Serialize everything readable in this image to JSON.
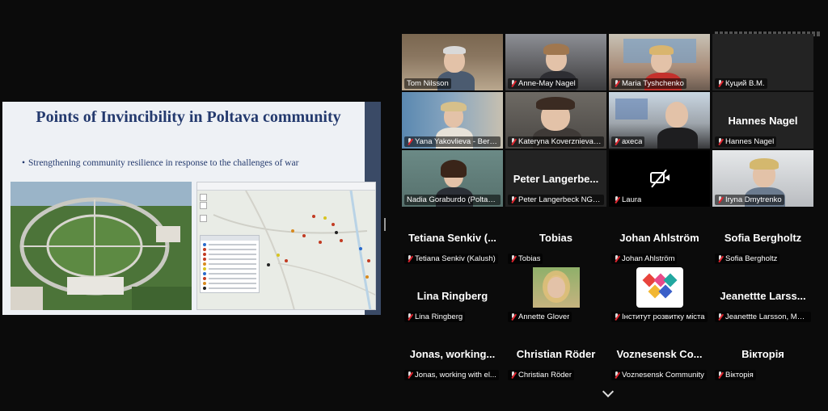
{
  "slide": {
    "title": "Points of Invincibility in Poltava community",
    "bullet": "Strengthening community resilience in response to the challenges of war",
    "bullet_marker": "•"
  },
  "participants": [
    {
      "display_name": "Tom Nilsson",
      "muted": false,
      "video": true
    },
    {
      "display_name": "Anne-May Nagel",
      "muted": true,
      "video": true
    },
    {
      "display_name": "Maria Tyshchenko",
      "muted": true,
      "video": true
    },
    {
      "display_name": "Куций В.М.",
      "muted": true,
      "video": false
    },
    {
      "display_name": "Yana Yakovlieva - Bery...",
      "muted": true,
      "video": true
    },
    {
      "display_name": "Kateryna Koverznieva ...",
      "muted": true,
      "video": true
    },
    {
      "display_name": "axeca",
      "muted": true,
      "video": true
    },
    {
      "display_name": "Hannes Nagel",
      "big_name": "Hannes Nagel",
      "muted": true,
      "video": false
    },
    {
      "display_name": "Nadia Goraburdo (Poltava)",
      "muted": false,
      "video": true,
      "active_speaker": true
    },
    {
      "display_name": "Peter Langerbeck NGO...",
      "big_name": "Peter Langerbe...",
      "muted": true,
      "video": false
    },
    {
      "display_name": "Laura",
      "muted": true,
      "video": false,
      "camera_off": true
    },
    {
      "display_name": "Iryna Dmytrenko",
      "muted": true,
      "video": true
    },
    {
      "display_name": "Tetiana Senkiv (Kalush)",
      "big_name": "Tetiana Senkiv (...",
      "muted": true,
      "video": false
    },
    {
      "display_name": "Tobias",
      "big_name": "Tobias",
      "muted": true,
      "video": false
    },
    {
      "display_name": "Johan Ahlström",
      "big_name": "Johan Ahlström",
      "muted": true,
      "video": false
    },
    {
      "display_name": "Sofia Bergholtz",
      "big_name": "Sofia Bergholtz",
      "muted": true,
      "video": false
    },
    {
      "display_name": "Lina Ringberg",
      "big_name": "Lina Ringberg",
      "muted": true,
      "video": false
    },
    {
      "display_name": "Annette Glover",
      "muted": true,
      "video": false,
      "avatar": true
    },
    {
      "display_name": "Інститут розвитку міста",
      "muted": true,
      "video": false,
      "logo": true
    },
    {
      "display_name": "Jeanettte Larsson, Mal...",
      "big_name": "Jeanettte Larss...",
      "muted": true,
      "video": false
    },
    {
      "display_name": "Jonas, working with el...",
      "big_name": "Jonas, working...",
      "muted": true,
      "video": false
    },
    {
      "display_name": "Christian Röder",
      "big_name": "Christian Röder",
      "muted": true,
      "video": false
    },
    {
      "display_name": "Voznesensk Community",
      "big_name": "Voznesensk Co...",
      "muted": true,
      "video": false
    },
    {
      "display_name": "Вікторія",
      "big_name": "Вікторія",
      "muted": true,
      "video": false
    }
  ],
  "colors": {
    "background": "#0b0b0b",
    "tile": "#232323",
    "active_speaker": "#23d96a",
    "muted_icon": "#e0262f",
    "slide_title": "#243a6e"
  },
  "icons": {
    "muted": "microphone-muted-icon",
    "camera_off": "camera-off-icon",
    "more": "chevron-down-icon"
  }
}
